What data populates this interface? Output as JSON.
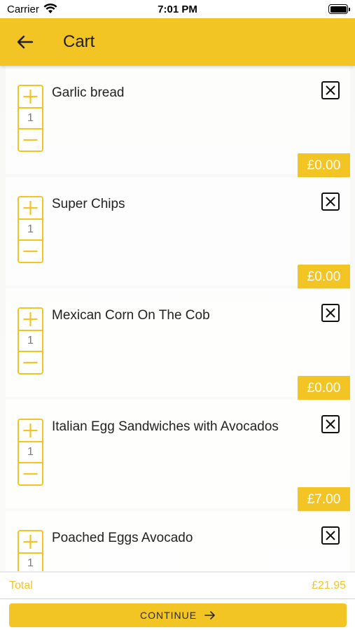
{
  "status_bar": {
    "carrier": "Carrier",
    "time": "7:01 PM"
  },
  "header": {
    "title": "Cart",
    "back_icon": "arrow-left-icon"
  },
  "cart": {
    "items": [
      {
        "name": "Garlic bread",
        "quantity": "1",
        "price": "£0.00"
      },
      {
        "name": "Super Chips",
        "quantity": "1",
        "price": "£0.00"
      },
      {
        "name": "Mexican Corn On The Cob",
        "quantity": "1",
        "price": "£0.00"
      },
      {
        "name": "Italian Egg Sandwiches with Avocados",
        "quantity": "1",
        "price": "£7.00"
      },
      {
        "name": "Poached Eggs Avocado",
        "quantity": "1",
        "price": ""
      }
    ]
  },
  "footer": {
    "total_label": "Total",
    "total_value": "£21.95",
    "continue_label": "CONTINUE",
    "continue_icon": "arrow-right-icon"
  },
  "colors": {
    "accent": "#f2c524",
    "text": "#222222"
  }
}
